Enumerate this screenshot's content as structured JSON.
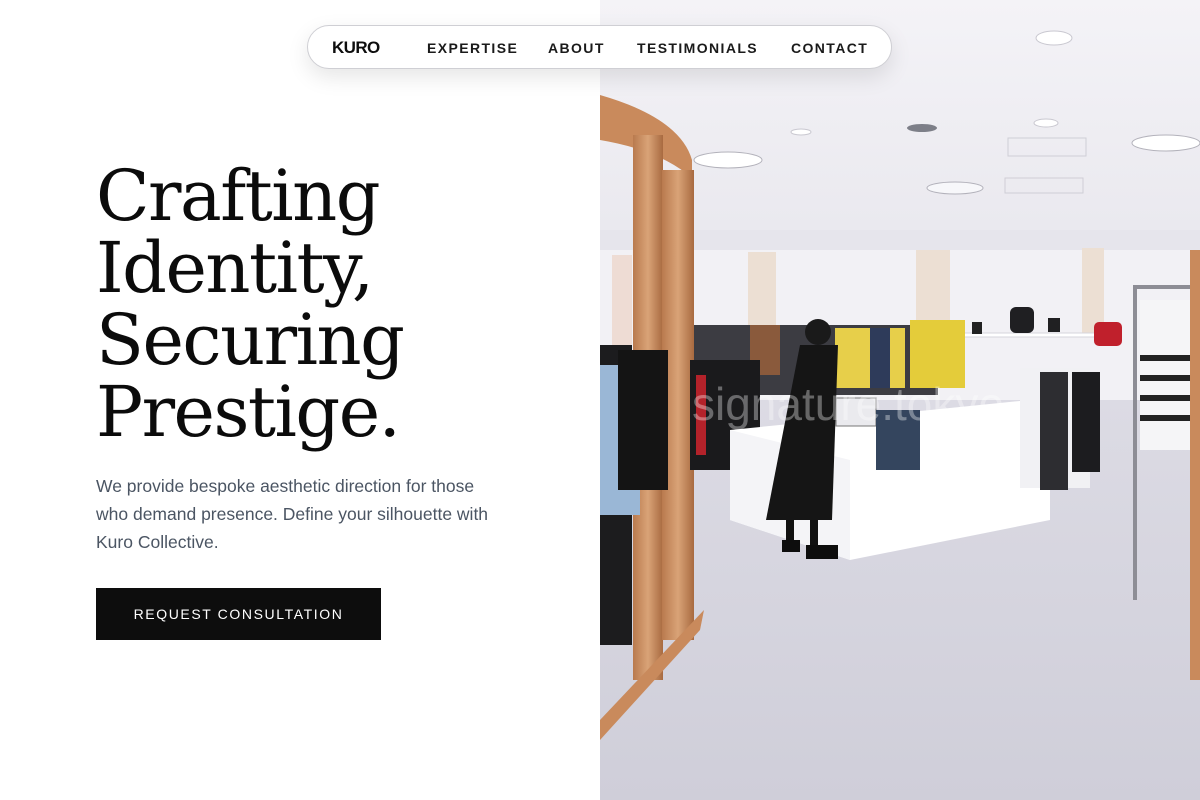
{
  "nav": {
    "brand": "KURO",
    "links": [
      {
        "label": "EXPERTISE"
      },
      {
        "label": "ABOUT"
      },
      {
        "label": "TESTIMONIALS"
      },
      {
        "label": "CONTACT"
      }
    ]
  },
  "hero": {
    "title_lines": [
      "Crafting",
      "Identity,",
      "Securing",
      "Prestige."
    ],
    "description": "We provide bespoke aesthetic direction for those who demand presence. Define your silhouette with Kuro Collective.",
    "cta_label": "REQUEST CONSULTATION"
  },
  "image": {
    "subject": "boutique-clothing-store-interior",
    "watermark": "signature.tokyo"
  },
  "colors": {
    "background": "#ffffff",
    "text_primary": "#0b0b0b",
    "text_secondary": "#4b5563",
    "button_bg": "#0d0d0d",
    "button_text": "#ffffff",
    "nav_border": "#cfcfd4"
  }
}
